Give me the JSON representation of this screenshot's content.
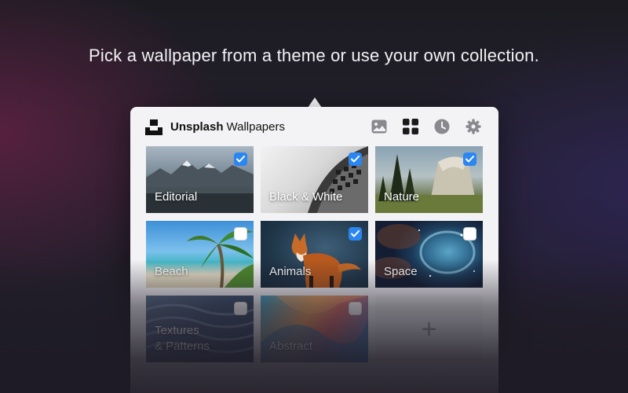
{
  "headline": "Pick a wallpaper from a theme or use your own collection.",
  "app": {
    "brand_bold": "Unsplash",
    "brand_rest": "Wallpapers",
    "logo_icon": "unsplash-logo-icon",
    "toolbar": {
      "icons": [
        "photo-icon",
        "grid-icon",
        "clock-icon",
        "gear-icon"
      ],
      "active": "grid-icon"
    }
  },
  "themes": [
    {
      "label": "Editorial",
      "checked": true
    },
    {
      "label": "Black & White",
      "checked": true
    },
    {
      "label": "Nature",
      "checked": true
    },
    {
      "label": "Beach",
      "checked": false
    },
    {
      "label": "Animals",
      "checked": true
    },
    {
      "label": "Space",
      "checked": false
    },
    {
      "label": "Textures\n& Patterns",
      "checked": false
    },
    {
      "label": "Abstract",
      "checked": false
    }
  ],
  "add_tile": {
    "glyph": "+"
  },
  "colors": {
    "accent_check": "#2b86f2",
    "popover_bg": "#f3f3f5",
    "icon_gray": "#8a8a8e"
  }
}
